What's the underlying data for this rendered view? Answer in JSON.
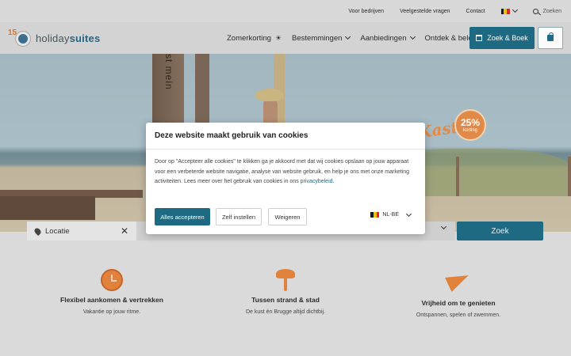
{
  "topbar": {
    "links": [
      "Voor bedrijven",
      "Veelgestelde vragen",
      "Contact"
    ],
    "search_label": "Zoeken"
  },
  "header": {
    "logo_number": "15",
    "logo_word_light": "holiday",
    "logo_word_bold": "suites",
    "nav": [
      {
        "label": "Zomerkorting",
        "icon": "sun-icon"
      },
      {
        "label": "Bestemmingen",
        "icon": "chevron-down-icon"
      },
      {
        "label": "Aanbiedingen",
        "icon": "chevron-down-icon"
      },
      {
        "label": "Ontdek & beleef",
        "icon": ""
      }
    ],
    "book_button": "Zoek & Boek"
  },
  "hero": {
    "post_text": "st mein",
    "promo_title": "Kast",
    "promo_percent": "25%",
    "promo_label": "korting"
  },
  "search": {
    "location_value": "Locatie",
    "submit_label": "Zoek"
  },
  "features": [
    {
      "icon": "clock-icon",
      "title": "Flexibel aankomen & vertrekken",
      "subtitle": "Vakantie op jouw ritme."
    },
    {
      "icon": "palm-tree-icon",
      "title": "Tussen strand & stad",
      "subtitle": "De kust én Brugge altijd dichtbij."
    },
    {
      "icon": "paper-plane-icon",
      "title": "Vrijheid om te genieten",
      "subtitle": "Ontspannen, spelen of zwemmen."
    }
  ],
  "cookie": {
    "title": "Deze website maakt gebruik van cookies",
    "body": "Door op \"Accepteer alle cookies\" te klikken ga je akkoord met dat wij cookies opslaan op jouw apparaat voor een verbeterde website navigatie, analyse van website gebruik, en help je ons met onze marketing activiteiten. Lees meer over het gebruik van cookies in ons",
    "link": "privacybeleid",
    "accept": "Alles accepteren",
    "settings": "Zelf instellen",
    "reject": "Weigeren",
    "lang": "NL-BE"
  },
  "colors": {
    "primary": "#1d6a82",
    "accent": "#e0823c"
  }
}
